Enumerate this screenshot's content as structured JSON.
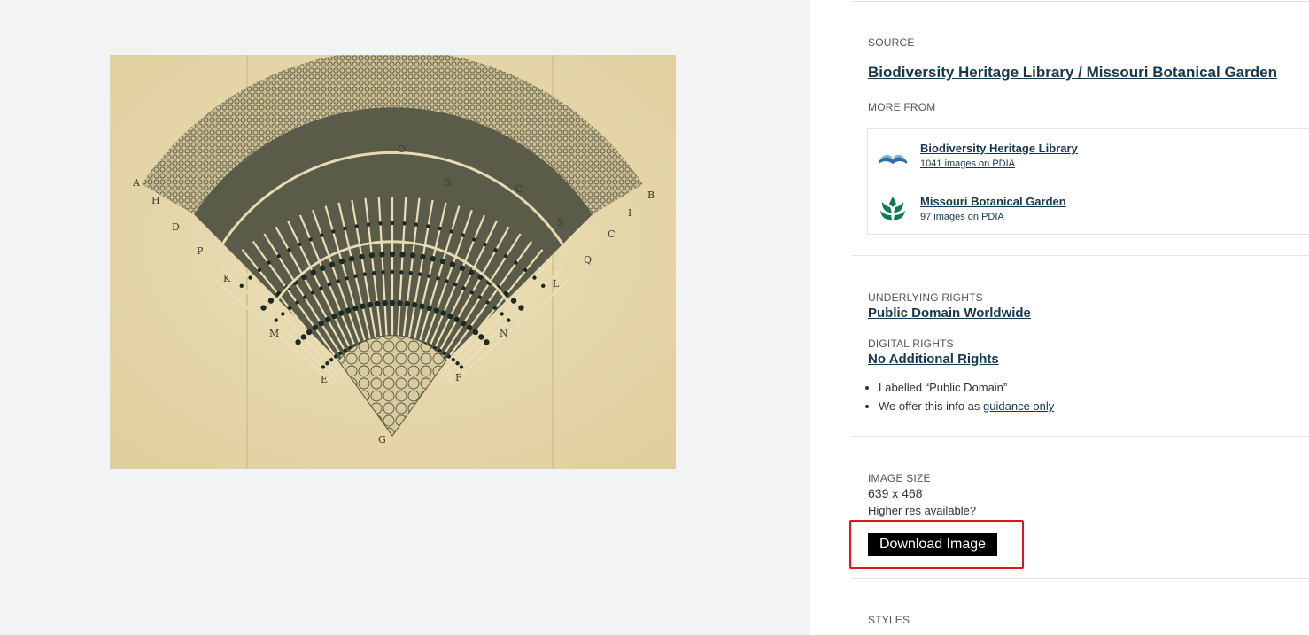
{
  "source": {
    "label": "SOURCE",
    "link": "Biodiversity Heritage Library / Missouri Botanical Garden"
  },
  "more_from": {
    "label": "MORE FROM",
    "items": [
      {
        "name": "Biodiversity Heritage Library",
        "count": "1041 images on PDIA",
        "icon": "open-book-logo"
      },
      {
        "name": "Missouri Botanical Garden",
        "count": "97 images on PDIA",
        "icon": "leaf-logo"
      }
    ]
  },
  "rights": {
    "underlying_label": "UNDERLYING RIGHTS",
    "underlying_link": "Public Domain Worldwide",
    "digital_label": "DIGITAL RIGHTS",
    "digital_link": "No Additional Rights",
    "bullet_1": "Labelled “Public Domain”",
    "bullet_2_prefix": "We offer this info as ",
    "bullet_2_link": "guidance only"
  },
  "image_size": {
    "label": "IMAGE SIZE",
    "value": "639 x 468",
    "higher_res": "Higher res available?",
    "download_label": "Download Image"
  },
  "styles": {
    "label": "STYLES"
  },
  "artwork": {
    "letters": [
      "A",
      "H",
      "D",
      "P",
      "K",
      "M",
      "E",
      "G",
      "F",
      "N",
      "L",
      "Q",
      "C",
      "I",
      "B",
      "O",
      "S",
      "S",
      "C"
    ]
  },
  "colors": {
    "link": "#16384f",
    "highlight": "#e0141e",
    "button_bg": "#000000",
    "viewer_bg": "#f1f3f5",
    "paper": "#e7d9ad"
  }
}
